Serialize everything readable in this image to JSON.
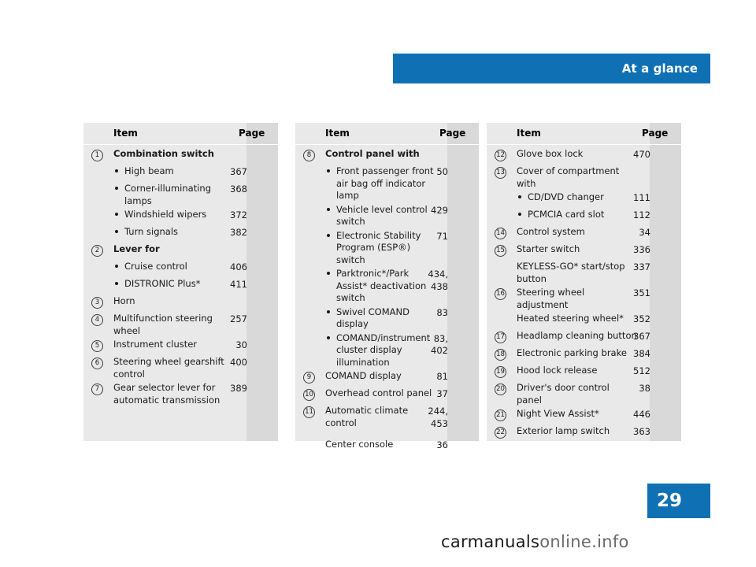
{
  "header": {
    "title": "At a glance"
  },
  "page_number": "29",
  "watermark": {
    "bold": "carmanuals",
    "light": "online.info"
  },
  "columns": [
    {
      "headers": {
        "item": "Item",
        "page": "Page"
      },
      "rows": [
        {
          "num": "1",
          "label": "Combination switch",
          "bold": true,
          "page": ""
        },
        {
          "sub": true,
          "label": "High beam",
          "page": "367"
        },
        {
          "sub": true,
          "label": "Corner-illuminating lamps",
          "page": "368"
        },
        {
          "sub": true,
          "label": "Windshield wipers",
          "page": "372"
        },
        {
          "sub": true,
          "label": "Turn signals",
          "page": "382"
        },
        {
          "num": "2",
          "label": "Lever for",
          "bold": true,
          "page": ""
        },
        {
          "sub": true,
          "label": "Cruise control",
          "page": "406"
        },
        {
          "sub": true,
          "label": "DISTRONIC Plus*",
          "page": "411"
        },
        {
          "num": "3",
          "label": "Horn",
          "page": ""
        },
        {
          "num": "4",
          "label": "Multifunction steering wheel",
          "page": "257"
        },
        {
          "num": "5",
          "label": "Instrument cluster",
          "page": "30"
        },
        {
          "num": "6",
          "label": "Steering wheel gearshift control",
          "page": "400"
        },
        {
          "num": "7",
          "label": "Gear selector lever for automatic transmission",
          "page": "389"
        }
      ]
    },
    {
      "headers": {
        "item": "Item",
        "page": "Page"
      },
      "rows": [
        {
          "num": "8",
          "label": "Control panel with",
          "bold": true,
          "page": ""
        },
        {
          "sub": true,
          "label": "Front passenger front air bag off indicator lamp",
          "page": "50"
        },
        {
          "sub": true,
          "label": "Vehicle level control switch",
          "page": "429"
        },
        {
          "sub": true,
          "label": "Electronic Stability Program (ESP®) switch",
          "page": "71",
          "esp": true
        },
        {
          "sub": true,
          "label": "Parktronic*/Park Assist* deactivation switch",
          "page": "434,\n438"
        },
        {
          "sub": true,
          "label": "Swivel COMAND display",
          "page": "83"
        },
        {
          "sub": true,
          "label": "COMAND/instrument cluster display illumination",
          "page": "83,\n402"
        },
        {
          "num": "9",
          "label": "COMAND display",
          "page": "81"
        },
        {
          "num": "10",
          "label": "Overhead control panel",
          "page": "37"
        },
        {
          "num": "11",
          "label": "Automatic climate control",
          "page": "244,\n453"
        },
        {
          "label": "Center console",
          "page": "36"
        }
      ]
    },
    {
      "headers": {
        "item": "Item",
        "page": "Page"
      },
      "rows": [
        {
          "num": "12",
          "label": "Glove box lock",
          "page": "470"
        },
        {
          "num": "13",
          "label": "Cover of compartment with",
          "page": ""
        },
        {
          "sub": true,
          "label": "CD/DVD changer",
          "page": "111"
        },
        {
          "sub": true,
          "label": "PCMCIA card slot",
          "page": "112"
        },
        {
          "num": "14",
          "label": "Control system",
          "page": "34"
        },
        {
          "num": "15",
          "label": "Starter switch",
          "page": "336"
        },
        {
          "label": "KEYLESS-GO* start/stop button",
          "page": "337",
          "noindent": true
        },
        {
          "num": "16",
          "label": "Steering wheel adjustment",
          "page": "351"
        },
        {
          "label": "Heated steering wheel*",
          "page": "352",
          "noindent": true
        },
        {
          "num": "17",
          "label": "Headlamp cleaning button",
          "page": "367"
        },
        {
          "num": "18",
          "label": "Electronic parking brake",
          "page": "384"
        },
        {
          "num": "19",
          "label": "Hood lock release",
          "page": "512"
        },
        {
          "num": "20",
          "label": "Driver's door control panel",
          "page": "38"
        },
        {
          "num": "21",
          "label": "Night View Assist*",
          "page": "446"
        },
        {
          "num": "22",
          "label": "Exterior lamp switch",
          "page": "363"
        }
      ]
    }
  ]
}
